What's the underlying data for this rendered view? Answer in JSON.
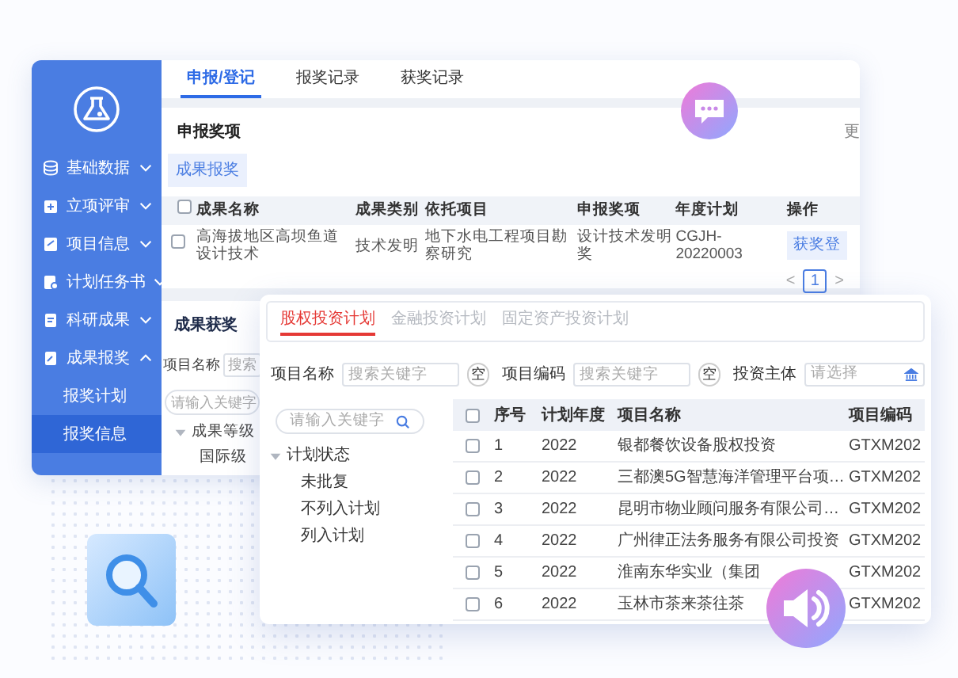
{
  "back_window": {
    "sidebar": {
      "items": [
        {
          "label": "基础数据",
          "expanded": false
        },
        {
          "label": "立项评审",
          "expanded": false
        },
        {
          "label": "项目信息",
          "expanded": false
        },
        {
          "label": "计划任务书",
          "expanded": false
        },
        {
          "label": "科研成果",
          "expanded": false
        },
        {
          "label": "成果报奖",
          "expanded": true,
          "children": [
            {
              "label": "报奖计划",
              "selected": false
            },
            {
              "label": "报奖信息",
              "selected": true
            }
          ]
        }
      ]
    },
    "tabs": [
      {
        "label": "申报/登记",
        "selected": true
      },
      {
        "label": "报奖记录",
        "selected": false
      },
      {
        "label": "获奖记录",
        "selected": false
      }
    ],
    "award_section": {
      "title": "申报奖项",
      "more": "更",
      "button": "成果报奖",
      "table": {
        "all_checked": false,
        "columns": [
          "成果名称",
          "成果类别",
          "依托项目",
          "申报奖项",
          "年度计划",
          "操作"
        ],
        "rows": [
          {
            "checked": false,
            "cells": [
              "高海拔地区高坝鱼道设计技术",
              "技术发明",
              "地下水电工程项目勘察研究",
              "设计技术发明奖",
              "CGJH-20220003"
            ],
            "action": "获奖登"
          }
        ]
      },
      "pagination": {
        "prev": "<",
        "pages": [
          {
            "label": "1",
            "selected": true
          }
        ],
        "next": ">"
      }
    },
    "results_section": {
      "title": "成果获奖",
      "filter_label": "项目名称",
      "filter_placeholder": "搜索",
      "tree_search_placeholder": "请输入关键字",
      "tree": [
        {
          "label": "成果等级",
          "expanded": true,
          "children": [
            {
              "label": "国际级"
            }
          ]
        }
      ]
    }
  },
  "front_window": {
    "tabs": [
      {
        "label": "股权投资计划",
        "selected": true
      },
      {
        "label": "金融投资计划",
        "selected": false
      },
      {
        "label": "固定资产投资计划",
        "selected": false
      }
    ],
    "filters": [
      {
        "kind": "text",
        "label": "项目名称",
        "placeholder": "搜索关键字",
        "clear": "空"
      },
      {
        "kind": "text",
        "label": "项目编码",
        "placeholder": "搜索关键字",
        "clear": "空"
      },
      {
        "kind": "select",
        "label": "投资主体",
        "placeholder": "请选择"
      }
    ],
    "tree_search_placeholder": "请输入关键字",
    "tree": [
      {
        "label": "计划状态",
        "expanded": true,
        "children": [
          {
            "label": "未批复"
          },
          {
            "label": "不列入计划"
          },
          {
            "label": "列入计划"
          }
        ]
      }
    ],
    "table": {
      "all_checked": false,
      "columns": [
        "序号",
        "计划年度",
        "项目名称",
        "项目编码"
      ],
      "rows": [
        {
          "checked": false,
          "cells": [
            "1",
            "2022",
            "银都餐饮设备股权投资",
            "GTXM202"
          ]
        },
        {
          "checked": false,
          "cells": [
            "2",
            "2022",
            "三都澳5G智慧海洋管理平台项…",
            "GTXM202"
          ]
        },
        {
          "checked": false,
          "cells": [
            "3",
            "2022",
            "昆明市物业顾问服务有限公司…",
            "GTXM202"
          ]
        },
        {
          "checked": false,
          "cells": [
            "4",
            "2022",
            "广州律正法务服务有限公司投资",
            "GTXM202"
          ]
        },
        {
          "checked": false,
          "cells": [
            "5",
            "2022",
            "淮南东华实业（集团",
            "GTXM202"
          ]
        },
        {
          "checked": false,
          "cells": [
            "6",
            "2022",
            "玉林市茶来茶往茶",
            "GTXM202"
          ]
        }
      ]
    }
  }
}
